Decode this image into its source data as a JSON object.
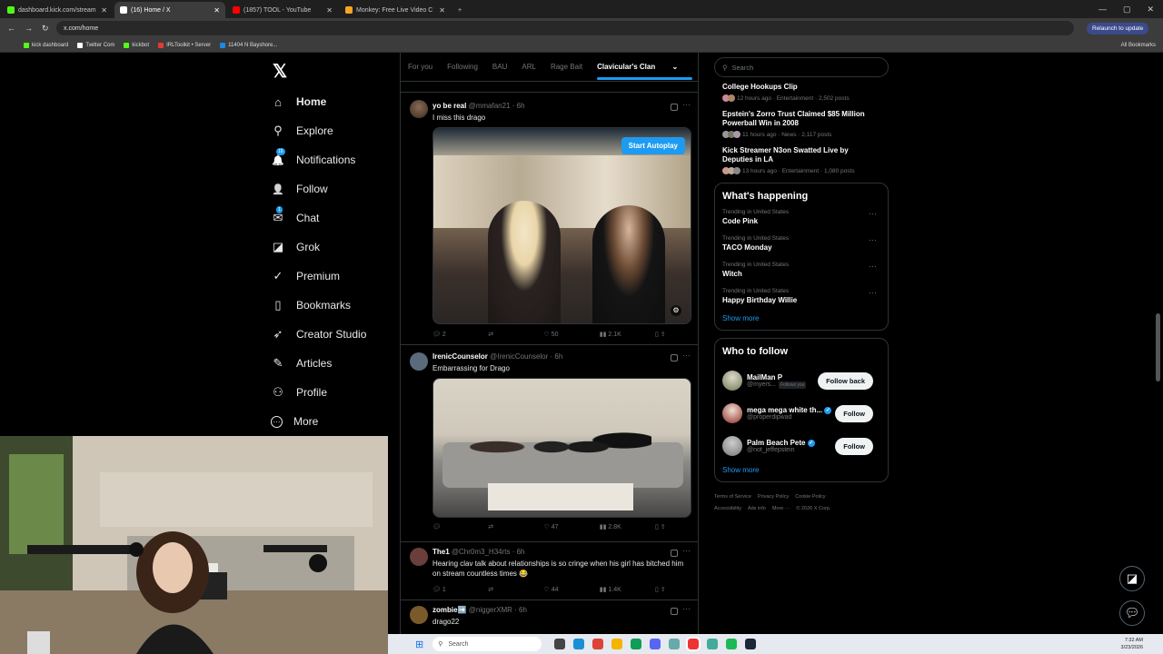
{
  "browser": {
    "tabs": [
      {
        "title": "dashboard.kick.com/stream",
        "color": "#53fc18"
      },
      {
        "title": "(16) Home / X",
        "color": "#ffffff"
      },
      {
        "title": "(1857) TOOL - YouTube",
        "color": "#ff0000"
      },
      {
        "title": "Monkey: Free Live Video C",
        "color": "#f5a623"
      }
    ],
    "url": "x.com/home",
    "relaunch": "Relaunch to update",
    "bookmarks": [
      "kick dashboard",
      "Twitter Com",
      "kickbot",
      "IRLToolkit • Server",
      "11404 N Bayshore..."
    ],
    "all_bookmarks": "All Bookmarks"
  },
  "nav": {
    "items": [
      {
        "label": "Home",
        "icon": "home-icon",
        "glyph": "⌂"
      },
      {
        "label": "Explore",
        "icon": "search-icon",
        "glyph": "⚲"
      },
      {
        "label": "Notifications",
        "icon": "bell-icon",
        "glyph": "🔔"
      },
      {
        "label": "Follow",
        "icon": "person-add-icon",
        "glyph": "👤"
      },
      {
        "label": "Chat",
        "icon": "mail-icon",
        "glyph": "✉"
      },
      {
        "label": "Grok",
        "icon": "grok-icon",
        "glyph": "◪"
      },
      {
        "label": "Premium",
        "icon": "premium-icon",
        "glyph": "✓"
      },
      {
        "label": "Bookmarks",
        "icon": "bookmark-icon",
        "glyph": "▯"
      },
      {
        "label": "Creator Studio",
        "icon": "rocket-icon",
        "glyph": "➶"
      },
      {
        "label": "Articles",
        "icon": "article-icon",
        "glyph": "✎"
      },
      {
        "label": "Profile",
        "icon": "profile-icon",
        "glyph": "⚇"
      },
      {
        "label": "More",
        "icon": "more-icon",
        "glyph": "⋯"
      }
    ],
    "notif_badge": "16",
    "chat_badge": "1"
  },
  "feed": {
    "tabs": [
      "For you",
      "Following",
      "BAU",
      "ARL",
      "Rage Bait",
      "Clavicular's Clan"
    ],
    "posts": [
      {
        "name": "yo be real",
        "handle": "@mmafan21 · 6h",
        "text": "I miss this drago",
        "autoplay": "Start Autoplay",
        "stats": {
          "replies": "2",
          "reposts": "",
          "likes": "50",
          "views": "2.1K"
        }
      },
      {
        "name": "IrenicCounselor",
        "handle": "@IrenicCounselor · 6h",
        "text": "Embarrassing for Drago",
        "stats": {
          "replies": "",
          "reposts": "",
          "likes": "47",
          "views": "2.8K"
        }
      },
      {
        "name": "The1",
        "handle": "@Chr0m3_H34rts · 6h",
        "text": "Hearing clav talk about relationships is so cringe when his girl has bitched him on stream countless times 😂",
        "stats": {
          "replies": "1",
          "reposts": "",
          "likes": "44",
          "views": "1.4K"
        }
      },
      {
        "name": "zombie➡️",
        "handle": "@niggerXMR · 6h",
        "text": "drago22"
      }
    ]
  },
  "sidebar": {
    "search_placeholder": "Search",
    "news": [
      {
        "title": "College Hookups Clip",
        "meta": "12 hours ago · Entertainment · 2,502 posts"
      },
      {
        "title": "Epstein's Zorro Trust Claimed $85 Million Powerball Win in 2008",
        "meta": "11 hours ago · News · 2,117 posts"
      },
      {
        "title": "Kick Streamer N3on Swatted Live by Deputies in LA",
        "meta": "13 hours ago · Entertainment · 1,080 posts"
      }
    ],
    "happening_title": "What's happening",
    "trends": [
      {
        "context": "Trending in United States",
        "name": "Code Pink"
      },
      {
        "context": "Trending in United States",
        "name": "TACO Monday"
      },
      {
        "context": "Trending in United States",
        "name": "Witch"
      },
      {
        "context": "Trending in United States",
        "name": "Happy Birthday Willie"
      }
    ],
    "show_more": "Show more",
    "wtf_title": "Who to follow",
    "wtf": [
      {
        "name": "MailMan P",
        "handle": "@myers...",
        "follows_you": "Follows you",
        "button": "Follow back"
      },
      {
        "name": "mega mega white th...",
        "handle": "@properdipwad",
        "button": "Follow"
      },
      {
        "name": "Palm Beach Pete",
        "handle": "@not_jeffepstein",
        "button": "Follow"
      }
    ],
    "show_more_2": "Show more",
    "footer": [
      "Terms of Service",
      "Privacy Policy",
      "Cookie Policy",
      "Accessibility",
      "Ads info",
      "More ···",
      "© 2026 X Corp."
    ]
  },
  "taskbar": {
    "search": "Search",
    "time": "7:32 AM",
    "date": "3/23/2026"
  }
}
